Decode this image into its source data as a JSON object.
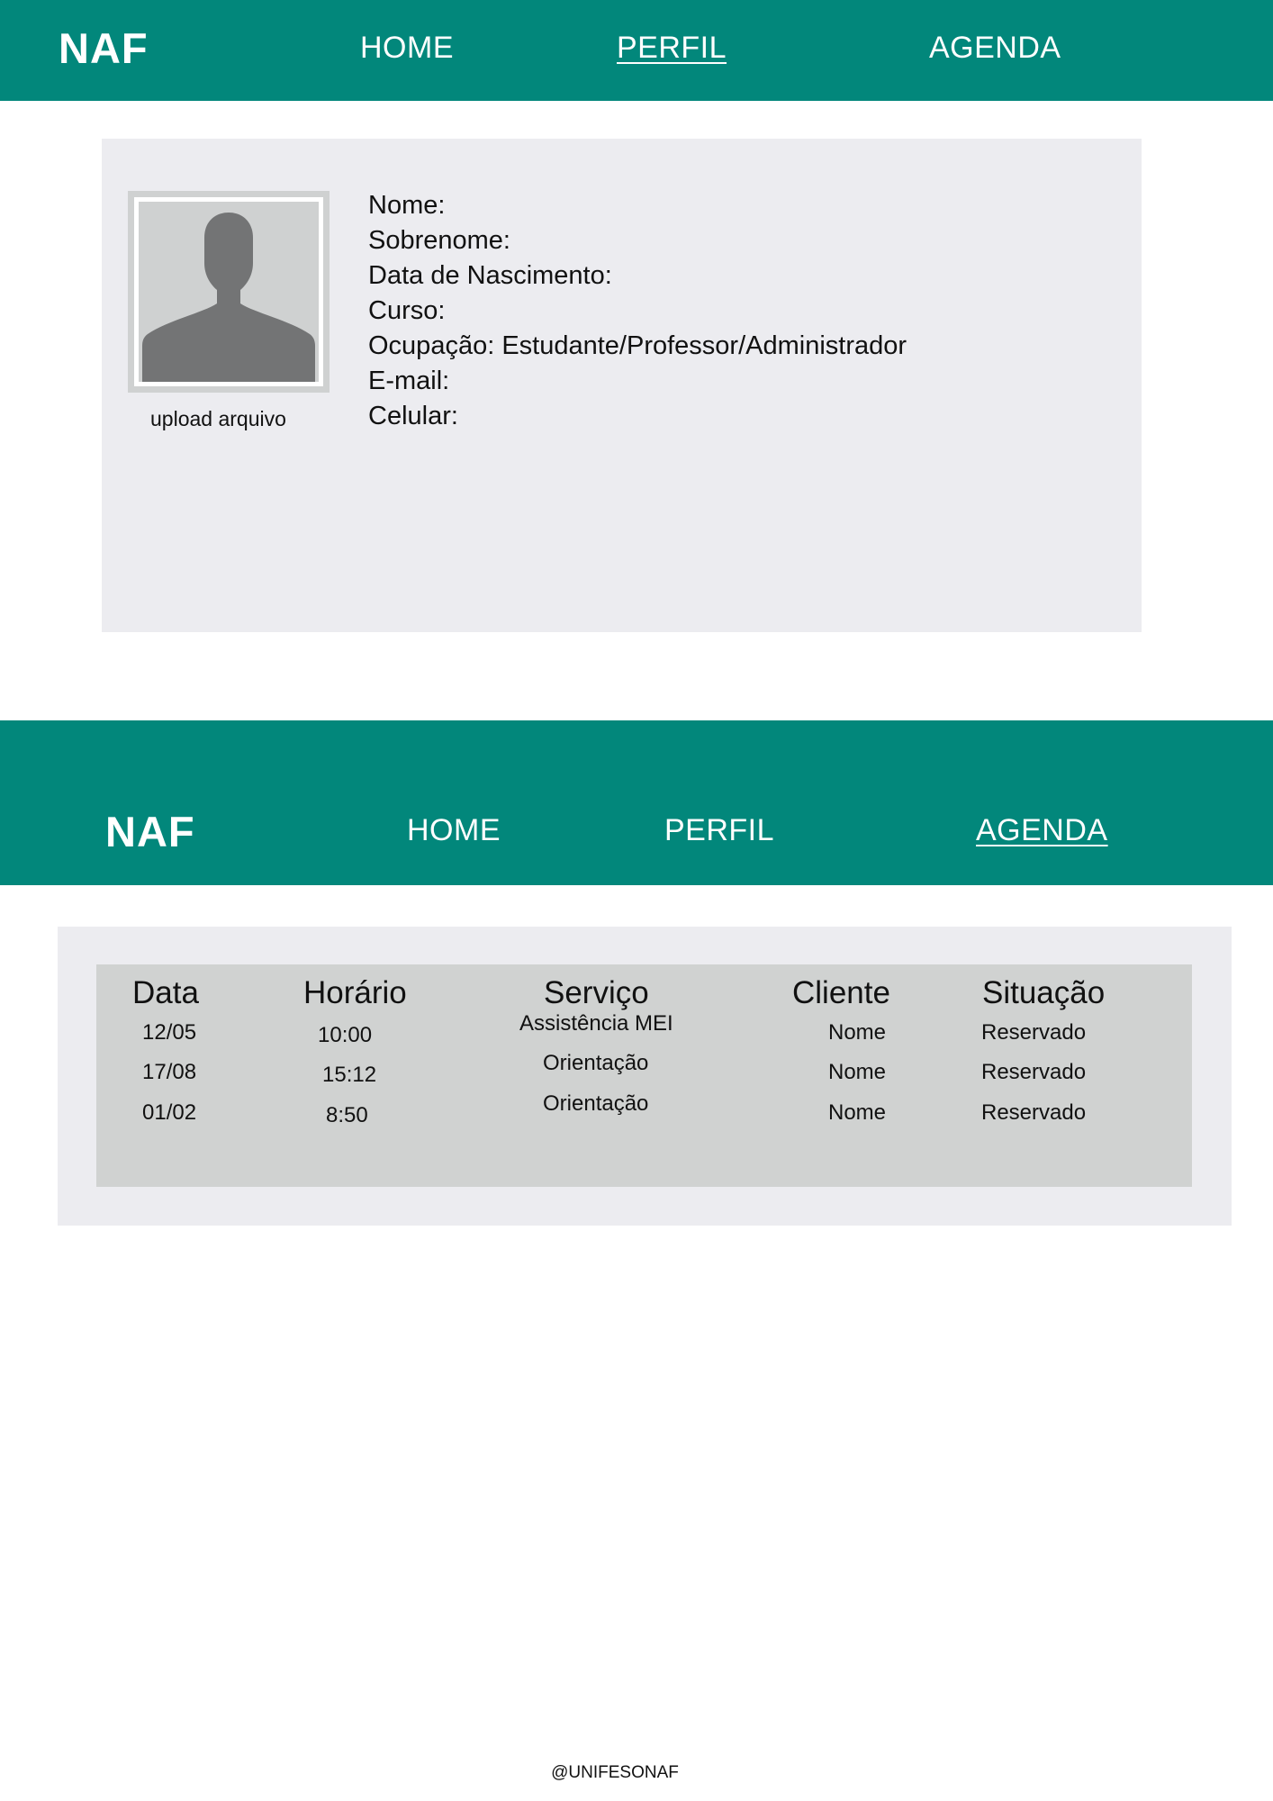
{
  "header_perfil": {
    "brand": "NAF",
    "nav": {
      "home": "HOME",
      "perfil": "PERFIL",
      "agenda": "AGENDA"
    },
    "active": "PERFIL"
  },
  "profile": {
    "upload_label": "upload arquivo",
    "avatar_icon": "user-silhouette-icon",
    "fields": [
      "Nome:",
      "Sobrenome:",
      "Data de Nascimento:",
      "Curso:",
      "Ocupação: Estudante/Professor/Administrador",
      "E-mail:",
      "Celular:"
    ]
  },
  "header_agenda": {
    "brand": "NAF",
    "nav": {
      "home": "HOME",
      "perfil": "PERFIL",
      "agenda": "AGENDA"
    },
    "active": "AGENDA"
  },
  "agenda": {
    "columns": [
      "Data",
      "Horário",
      "Serviço",
      "Cliente",
      "Situação"
    ],
    "rows": [
      {
        "data": "12/05",
        "horario": "10:00",
        "servico": "Assistência MEI",
        "cliente": "Nome",
        "situacao": "Reservado"
      },
      {
        "data": "17/08",
        "horario": "15:12",
        "servico": "Orientação",
        "cliente": "Nome",
        "situacao": "Reservado"
      },
      {
        "data": "01/02",
        "horario": "8:50",
        "servico": "Orientação",
        "cliente": "Nome",
        "situacao": "Reservado"
      }
    ]
  },
  "footer": {
    "handle": "@UNIFESONAF"
  },
  "colors": {
    "primary_teal": "#02877b",
    "card_background": "#ececf0",
    "table_background": "#d0d2d1",
    "avatar_silhouette": "#737475"
  }
}
